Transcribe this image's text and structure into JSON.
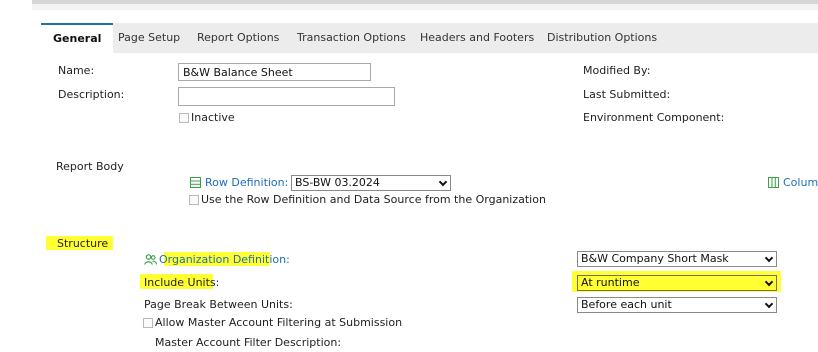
{
  "tabs": [
    {
      "label": "General",
      "active": true
    },
    {
      "label": "Page Setup"
    },
    {
      "label": "Report Options"
    },
    {
      "label": "Transaction Options"
    },
    {
      "label": "Headers and Footers"
    },
    {
      "label": "Distribution Options"
    }
  ],
  "general": {
    "name_label": "Name:",
    "name_value": "B&W Balance Sheet",
    "description_label": "Description:",
    "description_value": "",
    "inactive_label": "Inactive",
    "modified_by_label": "Modified By:",
    "last_submitted_label": "Last Submitted:",
    "environment_component_label": "Environment Component:"
  },
  "report_body": {
    "section_label": "Report Body",
    "row_definition_label": "Row Definition:",
    "row_definition_value": "BS-BW 03.2024",
    "use_row_def_label": "Use the Row Definition and Data Source from the Organization",
    "column_link_label": "Colum"
  },
  "structure": {
    "section_label": "Structure",
    "org_definition_label": "Organization Definition:",
    "org_definition_value": "B&W Company Short Mask",
    "include_units_label": "Include Units:",
    "include_units_value": "At runtime",
    "page_break_label": "Page Break Between Units:",
    "page_break_value": "Before each unit",
    "allow_master_label": "Allow Master Account Filtering at Submission",
    "master_filter_desc_label": "Master Account Filter Description:"
  },
  "colors": {
    "accent": "#1e6fb8",
    "highlight": "#ffff33",
    "icon_green": "#3aa04a"
  },
  "icons": [
    "row-definition-icon",
    "org-definition-icon",
    "column-definition-icon"
  ]
}
